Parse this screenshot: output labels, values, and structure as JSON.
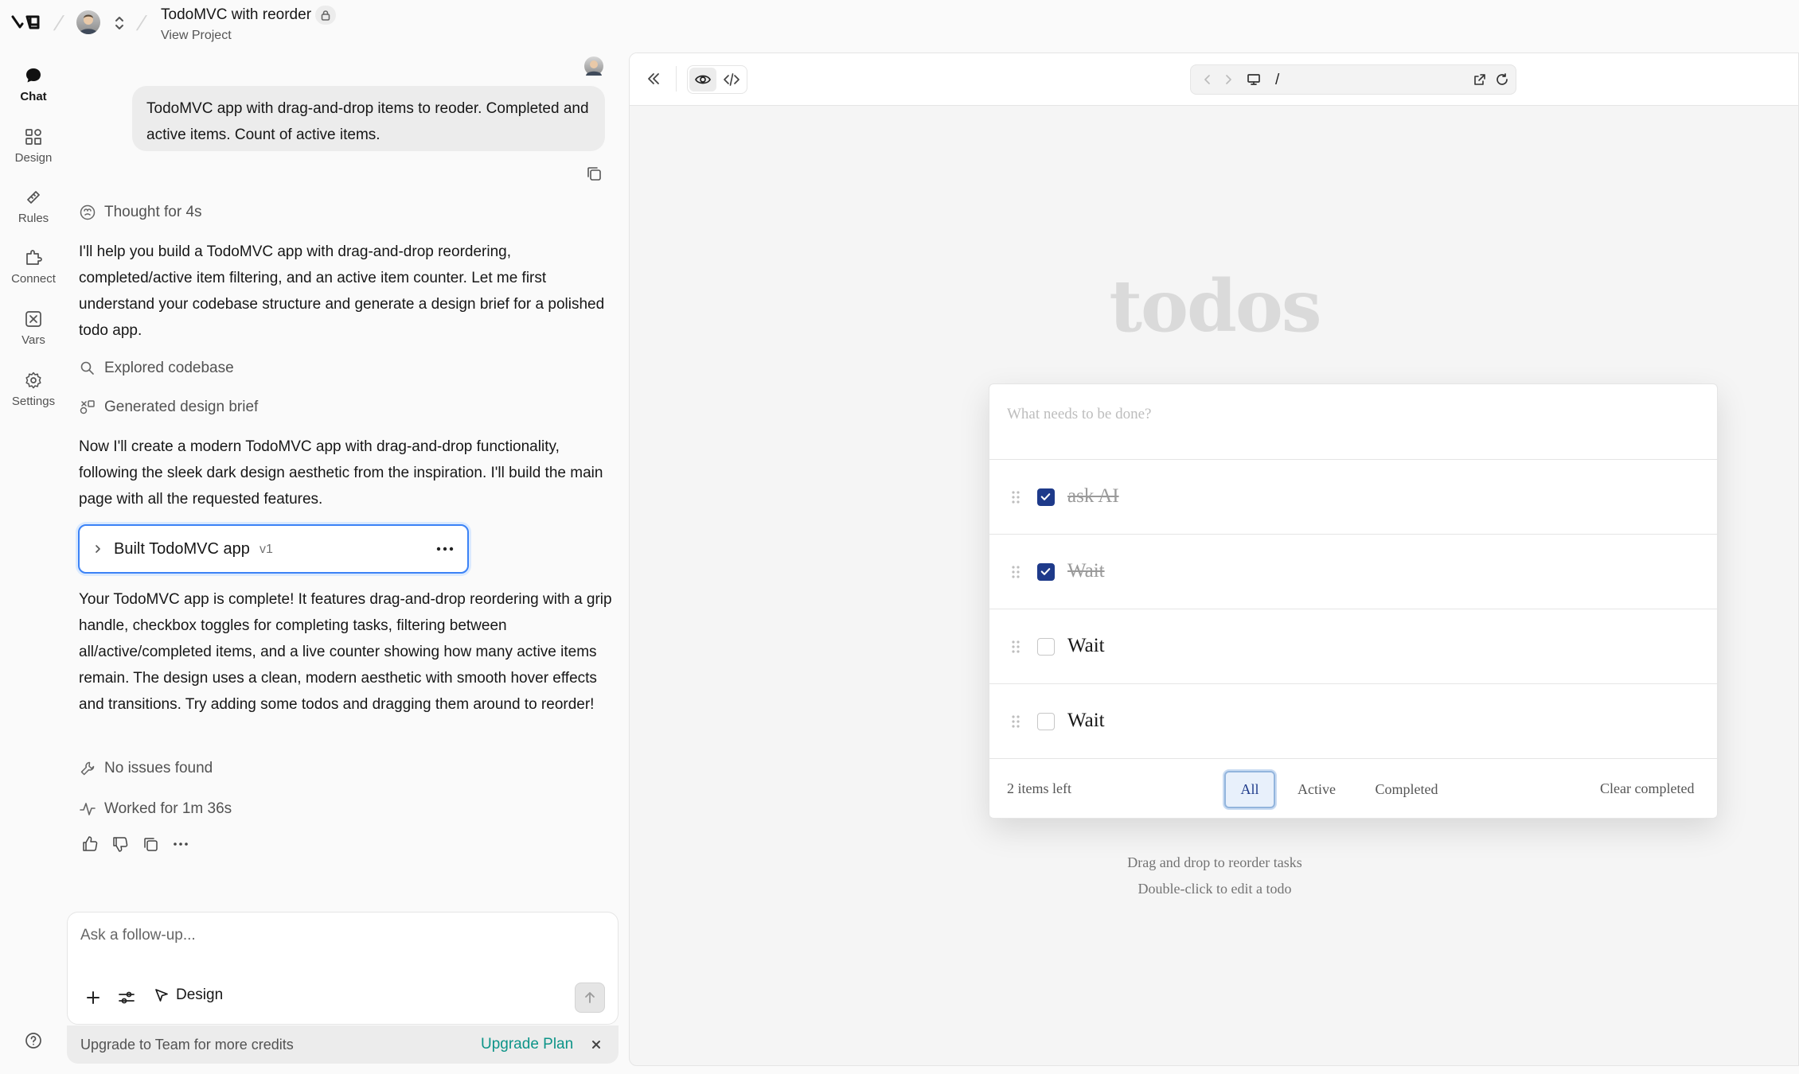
{
  "header": {
    "project_title": "TodoMVC with reorder",
    "view_project": "View Project"
  },
  "rail": {
    "items": [
      {
        "label": "Chat",
        "icon": "chat-icon",
        "active": true
      },
      {
        "label": "Design",
        "icon": "design-icon"
      },
      {
        "label": "Rules",
        "icon": "rules-icon"
      },
      {
        "label": "Connect",
        "icon": "connect-icon"
      },
      {
        "label": "Vars",
        "icon": "vars-icon"
      },
      {
        "label": "Settings",
        "icon": "gear-icon"
      }
    ]
  },
  "chat": {
    "user_message": "TodoMVC app with drag-and-drop items to reoder. Completed and active items. Count of active items.",
    "thought": "Thought for 4s",
    "intro": "I'll help you build a TodoMVC app with drag-and-drop reordering, completed/active item filtering, and an active item counter. Let me first understand your codebase structure and generate a design brief for a polished todo app.",
    "explored": "Explored codebase",
    "design_brief": "Generated design brief",
    "plan": "Now I'll create a modern TodoMVC app with drag-and-drop functionality, following the sleek dark design aesthetic from the inspiration. I'll build the main page with all the requested features.",
    "built_label": "Built TodoMVC app",
    "built_version": "v1",
    "summary": "Your TodoMVC app is complete! It features drag-and-drop reordering with a grip handle, checkbox toggles for completing tasks, filtering between all/active/completed items, and a live counter showing how many active items remain. The design uses a clean, modern aesthetic with smooth hover effects and transitions. Try adding some todos and dragging them around to reorder!",
    "no_issues": "No issues found",
    "worked": "Worked for 1m 36s"
  },
  "composer": {
    "placeholder": "Ask a follow-up...",
    "design_label": "Design",
    "upgrade_text": "Upgrade to Team for more credits",
    "upgrade_link": "Upgrade Plan"
  },
  "preview": {
    "url": "/",
    "app": {
      "title": "todos",
      "input_placeholder": "What needs to be done?",
      "todos": [
        {
          "text": "ask AI",
          "completed": true
        },
        {
          "text": "Wait",
          "completed": true
        },
        {
          "text": "Wait",
          "completed": false
        },
        {
          "text": "Wait",
          "completed": false
        }
      ],
      "items_left": "2 items left",
      "filters": [
        "All",
        "Active",
        "Completed"
      ],
      "selected_filter": "All",
      "clear_completed": "Clear completed",
      "hint1": "Drag and drop to reorder tasks",
      "hint2": "Double-click to edit a todo"
    }
  },
  "colors": {
    "accent_blue": "#3b82f6",
    "checkbox_checked": "#1e3a8a",
    "upgrade_link": "#0d9488"
  }
}
